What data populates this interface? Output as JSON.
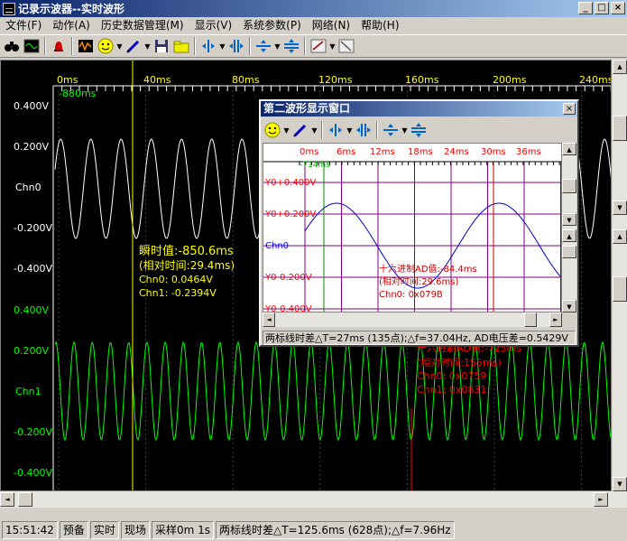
{
  "window": {
    "title": "记录示波器--实时波形",
    "btn_min": "_",
    "btn_max": "□",
    "btn_close": "×"
  },
  "menu": [
    "文件(F)",
    "动作(A)",
    "历史数据管理(M)",
    "显示(V)",
    "系统参数(P)",
    "网络(N)",
    "帮助(H)"
  ],
  "toolbar_icons": [
    "binoculars-icon",
    "scope-icon",
    "bell-icon",
    "waveform-icon",
    "smiley-icon",
    "pen-icon",
    "save-icon",
    "folder-icon",
    "cursor-v-icon",
    "move-h-icon",
    "cursor-h-icon",
    "move-v-icon",
    "zoom-box-icon",
    "fit-icon"
  ],
  "main_plot": {
    "x_ticks": [
      "0ms",
      "40ms",
      "80ms",
      "120ms",
      "160ms",
      "200ms",
      "240ms"
    ],
    "x_offset_label": "-880ms",
    "chn0": {
      "name": "Chn0",
      "ticks": [
        "0.400V",
        "0.200V",
        "-0.200V",
        "-0.400V"
      ],
      "color": "#ffffff"
    },
    "chn1": {
      "name": "Chn1",
      "ticks": [
        "0.400V",
        "0.200V",
        "-0.200V",
        "-0.400V"
      ],
      "color": "#00ff00"
    },
    "cursor1": {
      "color": "#ffff00",
      "label1": "瞬时值:-850.6ms",
      "label2": "(相对时间:29.4ms)",
      "label3": "Chn0: 0.0464V",
      "label4": "Chn1: -0.2394V"
    },
    "cursor2": {
      "color": "#ff0000",
      "label1": "十六进制AD值:-725ms",
      "label2": "(相对时间:155ms)",
      "label3": "Chn0: 0x0759",
      "label4": "Chn1: 0x0831"
    }
  },
  "sub_window": {
    "title": "第二波形显示窗口",
    "close": "×",
    "x_ticks": [
      "0ms",
      "6ms",
      "12ms",
      "18ms",
      "24ms",
      "30ms",
      "36ms"
    ],
    "x_offset_label": "-714ms",
    "y_ticks": [
      "Y0+0.400V",
      "Y0+0.200V",
      "Chn0",
      "Y0-0.200V",
      "Y0-0.400V"
    ],
    "cursor_label1": "十六进制AD值:-84.4ms",
    "cursor_label2": "(相对时间:29.6ms)",
    "cursor_label3": "Chn0: 0x079B",
    "status": "两标线时差△T=27ms (135点);△f=37.04Hz, AD电压差=0.5429V"
  },
  "status_bar": {
    "time": "15:51:42",
    "s1": "预备",
    "s2": "实时",
    "s3": "现场",
    "s4": "采样0m 1s",
    "s5": "两标线时差△T=125.6ms (628点);△f=7.96Hz"
  }
}
